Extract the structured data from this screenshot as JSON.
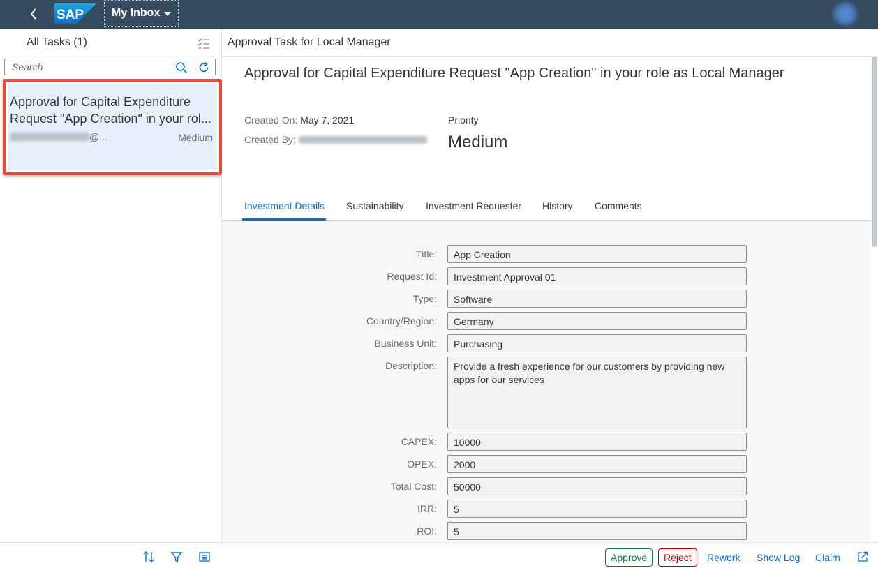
{
  "shell": {
    "app_menu_label": "My Inbox",
    "logo_text": "SAP",
    "icons": [
      "back-icon",
      "caret-down-icon",
      "user-avatar"
    ]
  },
  "master": {
    "title": "All Tasks (1)",
    "search_placeholder": "Search",
    "task": {
      "title_line1": "Approval for Capital Expenditure",
      "title_line2": "Request \"App Creation\" in your rol...",
      "sender_suffix": "@...",
      "priority": "Medium"
    },
    "footer_icons": [
      "sort-icon",
      "filter-icon",
      "group-icon"
    ]
  },
  "detail": {
    "header_title": "Approval Task for Local Manager",
    "object_title": "Approval for Capital Expenditure Request \"App Creation\" in your role as Local Manager",
    "created_on_label": "Created On:",
    "created_on_value": "May 7, 2021",
    "created_by_label": "Created By:",
    "priority_label": "Priority",
    "priority_value": "Medium",
    "tabs": [
      "Investment Details",
      "Sustainability",
      "Investment Requester",
      "History",
      "Comments"
    ],
    "active_tab": "Investment Details",
    "form": [
      {
        "label": "Title:",
        "value": "App Creation"
      },
      {
        "label": "Request Id:",
        "value": "Investment Approval 01"
      },
      {
        "label": "Type:",
        "value": "Software"
      },
      {
        "label": "Country/Region:",
        "value": "Germany"
      },
      {
        "label": "Business Unit:",
        "value": "Purchasing"
      },
      {
        "label": "Description:",
        "value": "Provide a fresh experience for our customers by providing new apps for our services"
      },
      {
        "label": "CAPEX:",
        "value": "10000"
      },
      {
        "label": "OPEX:",
        "value": "2000"
      },
      {
        "label": "Total Cost:",
        "value": "50000"
      },
      {
        "label": "IRR:",
        "value": "5"
      },
      {
        "label": "ROI:",
        "value": "5"
      }
    ]
  },
  "footer": {
    "approve": "Approve",
    "reject": "Reject",
    "rework": "Rework",
    "show_log": "Show Log",
    "claim": "Claim"
  },
  "colors": {
    "shell": "#354a5f",
    "accent": "#0a6ed1",
    "approve": "#107e3e",
    "reject": "#bb0000",
    "highlight": "#e9493a",
    "selected_item": "#e5f0fa"
  }
}
